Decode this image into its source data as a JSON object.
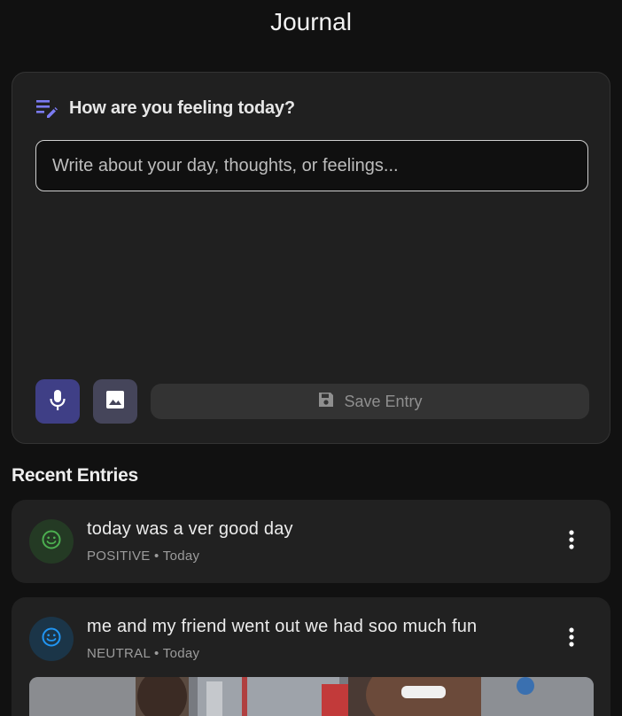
{
  "app": {
    "title": "Journal"
  },
  "compose": {
    "heading": "How are you feeling today?",
    "input_placeholder": "Write about your day, thoughts, or feelings...",
    "input_value": "",
    "mic_icon": "mic-icon",
    "image_icon": "image-icon",
    "save_label": "Save Entry",
    "save_icon": "save-icon"
  },
  "recent": {
    "title": "Recent Entries",
    "entries": [
      {
        "text": "today was a ver good day",
        "mood": "POSITIVE",
        "date": "Today",
        "meta": "POSITIVE • Today",
        "mood_icon": "smile-icon",
        "mood_color": "#4caf50"
      },
      {
        "text": "me and my friend went out we had soo much fun",
        "mood": "NEUTRAL",
        "date": "Today",
        "meta": "NEUTRAL • Today",
        "mood_icon": "smile-icon",
        "mood_color": "#2196f3"
      }
    ]
  },
  "colors": {
    "accent": "#6b6bf0",
    "background": "#111111",
    "card": "#212121",
    "mic_button": "#3f3f86"
  }
}
